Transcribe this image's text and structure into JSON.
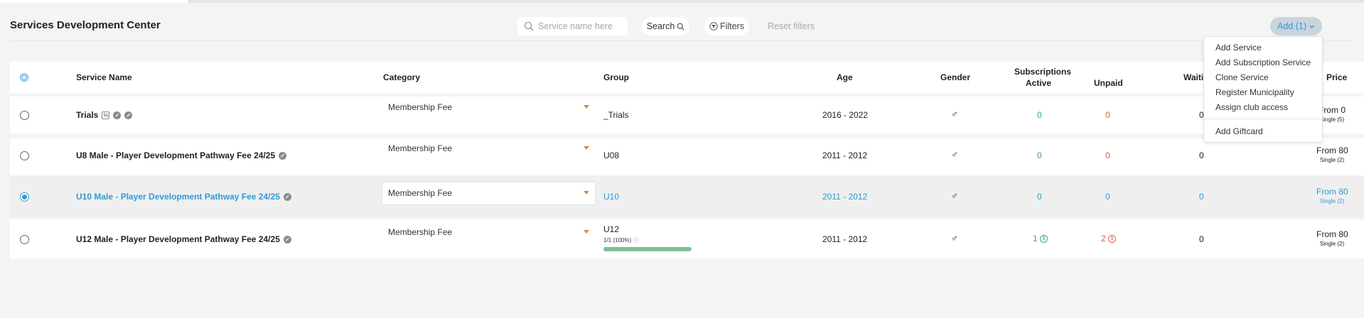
{
  "page_title": "Services Development Center",
  "toolbar": {
    "search_placeholder": "Service name here",
    "search_label": "Search",
    "filters_label": "Filters",
    "reset_label": "Reset filters",
    "add_label": "Add (1)"
  },
  "add_menu": {
    "items": [
      "Add Service",
      "Add Subscription Service",
      "Clone Service",
      "Register Municipality",
      "Assign club access",
      "Add Giftcard"
    ]
  },
  "table": {
    "headers": {
      "service_name": "Service Name",
      "category": "Category",
      "group": "Group",
      "age": "Age",
      "gender": "Gender",
      "subscriptions": "Subscriptions",
      "active": "Active",
      "unpaid": "Unpaid",
      "waiting": "Waiti",
      "price": "Price"
    },
    "rows": [
      {
        "name": "Trials",
        "category": "Membership Fee",
        "group": "_Trials",
        "age": "2016 - 2022",
        "gender_symbol": "♂",
        "active": "0",
        "unpaid": "0",
        "waiting": "0",
        "price": "From 0",
        "price_sub": "Single (5)",
        "pct_badge": "%"
      },
      {
        "name": "U8 Male - Player Development Pathway Fee 24/25",
        "category": "Membership Fee",
        "group": "U08",
        "age": "2011 - 2012",
        "gender_symbol": "♂",
        "active": "0",
        "unpaid": "0",
        "waiting": "0",
        "price": "From 80",
        "price_sub": "Single (2)"
      },
      {
        "name": "U10 Male - Player Development Pathway Fee 24/25",
        "category": "Membership Fee",
        "group": "U10",
        "age": "2011 - 2012",
        "gender_symbol": "♂",
        "active": "0",
        "unpaid": "0",
        "waiting": "0",
        "price": "From 80",
        "price_sub": "Single (2)"
      },
      {
        "name": "U12 Male - Player Development Pathway Fee 24/25",
        "category": "Membership Fee",
        "group": "U12",
        "group_capacity": "1/1 (100%)",
        "group_capacity_fill": 1.0,
        "age": "2011 - 2012",
        "gender_symbol": "♂",
        "active": "1",
        "unpaid": "2",
        "waiting": "0",
        "price": "From 80",
        "price_sub": "Single (2)",
        "currency_symbol": "$"
      }
    ]
  },
  "colors": {
    "accent": "#2e9bd6",
    "active_green": "#3ca86d",
    "unpaid_red": "#e2594e",
    "dropdown_arrow": "#d98a3b"
  }
}
